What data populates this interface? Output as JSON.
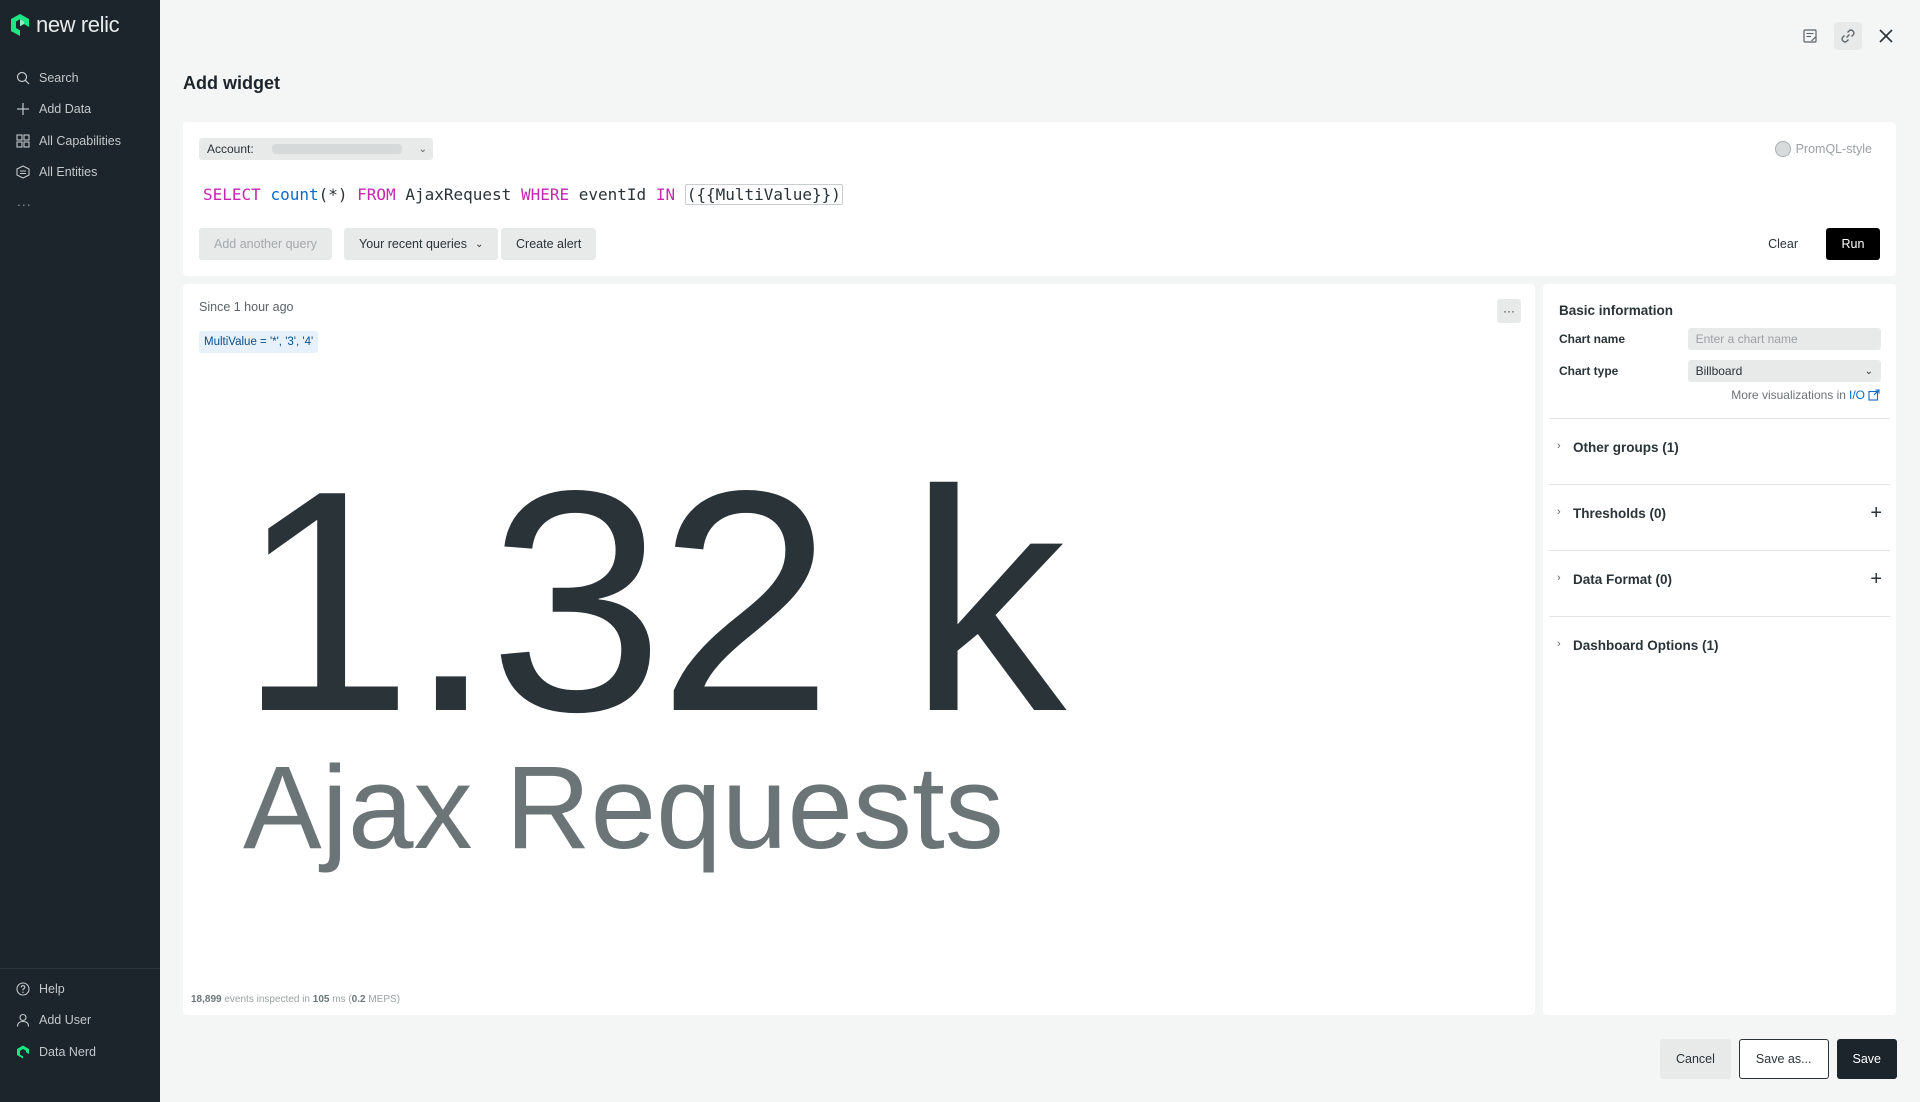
{
  "brand": {
    "name": "new relic"
  },
  "sidebar": {
    "items": [
      {
        "label": "Search",
        "icon": "search-icon"
      },
      {
        "label": "Add Data",
        "icon": "plus-icon"
      },
      {
        "label": "All Capabilities",
        "icon": "grid-icon"
      },
      {
        "label": "All Entities",
        "icon": "entities-icon"
      }
    ],
    "more": "...",
    "bottom_items": [
      {
        "label": "Help",
        "icon": "help-icon"
      },
      {
        "label": "Add User",
        "icon": "user-icon"
      },
      {
        "label": "Data Nerd",
        "icon": "newrelic-icon"
      }
    ]
  },
  "page": {
    "title": "Add widget"
  },
  "query": {
    "account_label": "Account:",
    "promql_label": "PromQL-style",
    "nrql": {
      "select": "SELECT",
      "count": "count",
      "count_args": "(*)",
      "from": "FROM",
      "event_type": "AjaxRequest",
      "where": "WHERE",
      "attribute": "eventId",
      "in": "IN",
      "variable": "({{MultiValue}})"
    },
    "buttons": {
      "add_another": "Add another query",
      "recent": "Your recent queries",
      "create_alert": "Create alert",
      "clear": "Clear",
      "run": "Run"
    }
  },
  "chart": {
    "since": "Since 1 hour ago",
    "filter_chip": "MultiValue = '*', '3', '4'",
    "more": "···",
    "value": "1.32 k",
    "label": "Ajax Requests",
    "footer": {
      "events": "18,899",
      "events_text": " events inspected in ",
      "ms": "105",
      "ms_text": " ms (",
      "meps": "0.2",
      "meps_text": " MEPS)"
    }
  },
  "chart_data": {
    "type": "table",
    "value": 1320,
    "display": "1.32 k",
    "label": "Ajax Requests"
  },
  "settings": {
    "title": "Basic information",
    "chart_name_label": "Chart name",
    "chart_name_placeholder": "Enter a chart name",
    "chart_type_label": "Chart type",
    "chart_type_value": "Billboard",
    "more_vis_text": "More visualizations in",
    "more_vis_link": "I/O",
    "sections": [
      {
        "name": "Other groups (1)",
        "addable": false
      },
      {
        "name": "Thresholds (0)",
        "addable": true
      },
      {
        "name": "Data Format (0)",
        "addable": true
      },
      {
        "name": "Dashboard Options (1)",
        "addable": false
      }
    ]
  },
  "footer_buttons": {
    "cancel": "Cancel",
    "save_as": "Save as...",
    "save": "Save"
  },
  "colors": {
    "sidebar_bg": "#1d252c",
    "keyword": "#c427b0",
    "function": "#0b6acb",
    "run_button": "#000000",
    "link": "#0b6acb"
  }
}
